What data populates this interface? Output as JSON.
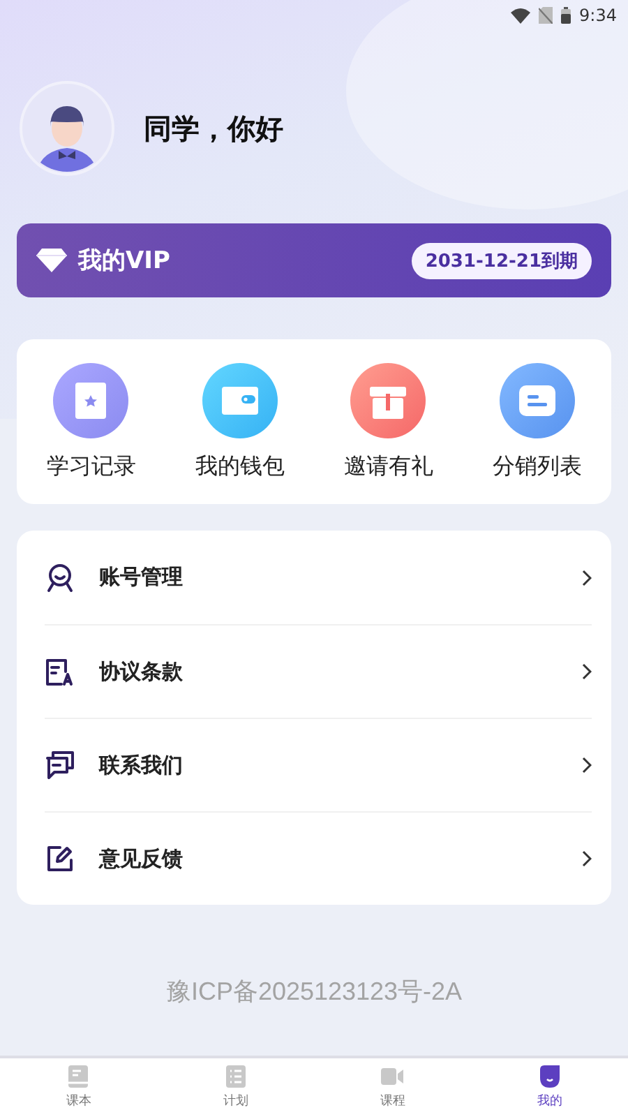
{
  "status_bar": {
    "time": "9:34"
  },
  "profile": {
    "greeting": "同学，你好"
  },
  "vip": {
    "title": "我的VIP",
    "expiry": "2031-12-21到期"
  },
  "shortcuts": [
    {
      "label": "学习记录"
    },
    {
      "label": "我的钱包"
    },
    {
      "label": "邀请有礼"
    },
    {
      "label": "分销列表"
    }
  ],
  "menu": [
    {
      "label": "账号管理"
    },
    {
      "label": "协议条款"
    },
    {
      "label": "联系我们"
    },
    {
      "label": "意见反馈"
    }
  ],
  "footer": {
    "icp": "豫ICP备2025123123号-2A"
  },
  "tab_bar": [
    {
      "label": "课本",
      "selected": false
    },
    {
      "label": "计划",
      "selected": false
    },
    {
      "label": "课程",
      "selected": false
    },
    {
      "label": "我的",
      "selected": true
    }
  ]
}
